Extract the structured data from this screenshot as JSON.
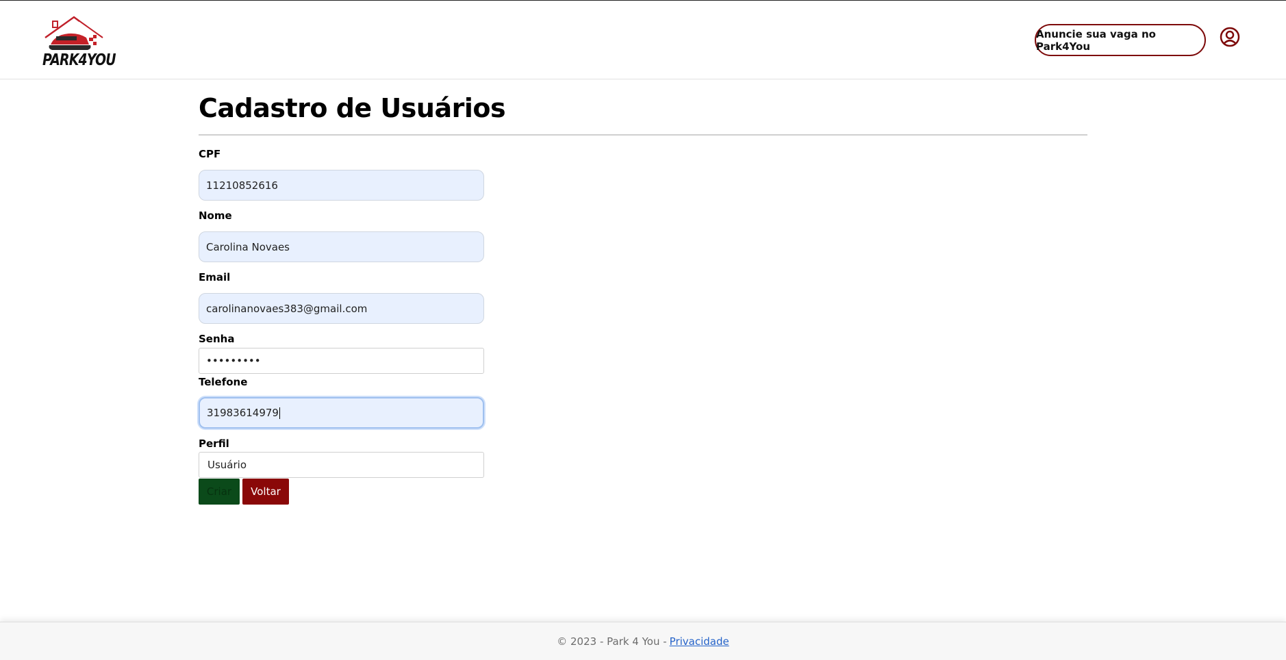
{
  "header": {
    "logo_text": "PARK4YOU",
    "announce_button": "Anuncie sua vaga no Park4You",
    "user_icon": "user-circle-icon",
    "brand_color": "#7d0a0a"
  },
  "page": {
    "title": "Cadastro de Usuários"
  },
  "form": {
    "cpf": {
      "label": "CPF",
      "value": "11210852616"
    },
    "nome": {
      "label": "Nome",
      "value": "Carolina Novaes"
    },
    "email": {
      "label": "Email",
      "value": "carolinanovaes383@gmail.com"
    },
    "senha": {
      "label": "Senha",
      "value": "•••••••••"
    },
    "telefone": {
      "label": "Telefone",
      "value": "31983614979"
    },
    "perfil": {
      "label": "Perfil",
      "value": "Usuário"
    },
    "buttons": {
      "criar": "Criar",
      "voltar": "Voltar"
    },
    "colors": {
      "criar": "#0b4a1a",
      "voltar": "#8a0808",
      "autofill": "#e8f0fe"
    }
  },
  "footer": {
    "text": "© 2023 - Park 4 You -",
    "link": "Privacidade"
  }
}
